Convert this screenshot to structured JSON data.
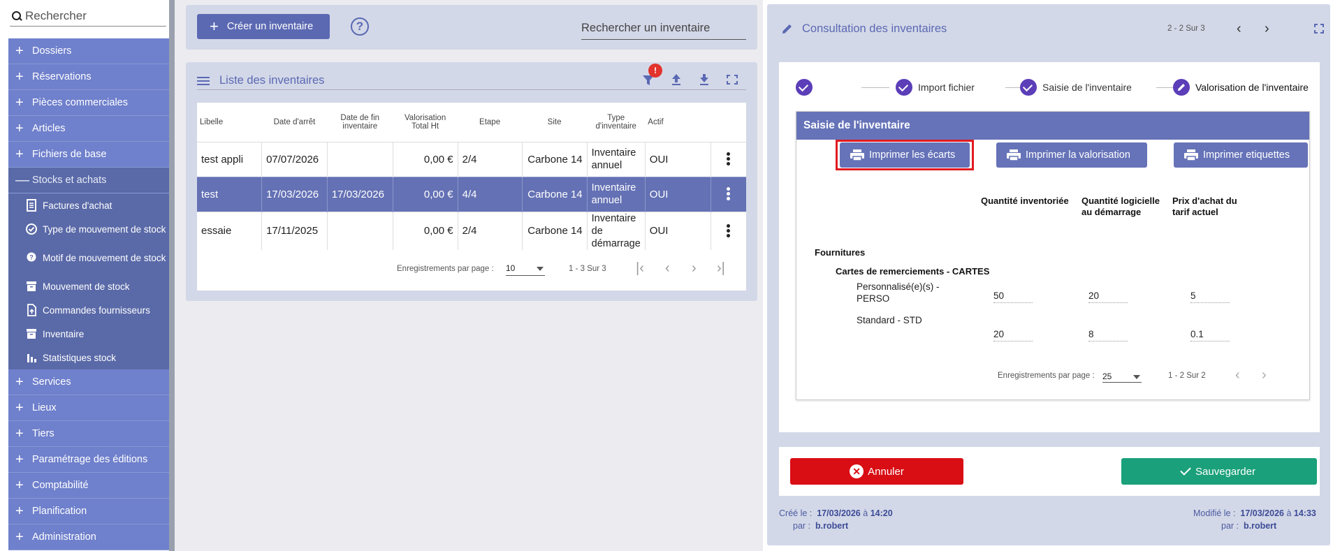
{
  "sidebar": {
    "search_placeholder": "Rechercher",
    "items_top": [
      "Dossiers",
      "Réservations",
      "Pièces commerciales",
      "Articles",
      "Fichiers de base"
    ],
    "open_item": "Stocks et achats",
    "sub_items": [
      "Factures d'achat",
      "Type de mouvement de stock",
      "Motif de mouvement de stock",
      "Mouvement de stock",
      "Commandes fournisseurs",
      "Inventaire",
      "Statistiques stock"
    ],
    "items_bottom": [
      "Services",
      "Lieux",
      "Tiers",
      "Paramétrage des éditions",
      "Comptabilité",
      "Planification",
      "Administration"
    ]
  },
  "toolbar": {
    "create_label": "Créer un inventaire",
    "search_placeholder": "Rechercher un inventaire"
  },
  "list": {
    "title": "Liste des inventaires",
    "filter_badge": "!",
    "columns": [
      "Libelle",
      "Date d'arrêt",
      "Date de fin inventaire",
      "Valorisation Total Ht",
      "Etape",
      "Site",
      "Type d'inventaire",
      "Actif"
    ],
    "rows": [
      {
        "libelle": "test appli",
        "date_arret": "07/07/2026",
        "date_fin": "",
        "valorisation": "0,00 €",
        "etape": "2/4",
        "site": "Carbone 14",
        "type": "Inventaire annuel",
        "actif": "OUI"
      },
      {
        "libelle": "test",
        "date_arret": "17/03/2026",
        "date_fin": "17/03/2026",
        "valorisation": "0,00 €",
        "etape": "4/4",
        "site": "Carbone 14",
        "type": "Inventaire annuel",
        "actif": "OUI"
      },
      {
        "libelle": "essaie",
        "date_arret": "17/11/2025",
        "date_fin": "",
        "valorisation": "0,00 €",
        "etape": "2/4",
        "site": "Carbone 14",
        "type": "Inventaire de démarrage",
        "actif": "OUI"
      }
    ],
    "pager": {
      "label": "Enregistrements par page :",
      "per_page": "10",
      "count": "1 - 3 Sur 3"
    }
  },
  "detail": {
    "title": "Consultation des inventaires",
    "count": "2 - 2 Sur 3",
    "steps": [
      "Import fichier",
      "Saisie de l'inventaire",
      "Valorisation de l'inventaire"
    ],
    "section_title": "Saisie de l'inventaire",
    "buttons": {
      "print_gaps": "Imprimer les écarts",
      "print_valuation": "Imprimer la valorisation",
      "print_labels": "Imprimer etiquettes"
    },
    "columns": {
      "qty_inv": "Quantité inventoriée",
      "qty_log": "Quantité logicielle au démarrage",
      "price": "Prix d'achat du tarif actuel"
    },
    "group": "Fournitures",
    "subgroup": "Cartes de remerciements - CARTES",
    "items": [
      {
        "label": "Personnalisé(e)(s) - PERSO",
        "qty_inv": "50",
        "qty_log": "20",
        "price": "5"
      },
      {
        "label": "Standard - STD",
        "qty_inv": "20",
        "qty_log": "8",
        "price": "0.1"
      }
    ],
    "pager": {
      "label": "Enregistrements par page :",
      "per_page": "25",
      "count": "1 - 2 Sur 2"
    }
  },
  "actions": {
    "cancel": "Annuler",
    "save": "Sauvegarder"
  },
  "meta": {
    "created_label": "Créé le :",
    "created_date": "17/03/2026",
    "created_at": "à",
    "created_time": "14:20",
    "by_label": "par :",
    "created_by": "b.robert",
    "modified_label": "Modifié le :",
    "modified_date": "17/03/2026",
    "modified_time": "14:33",
    "modified_by": "b.robert"
  },
  "colors": {
    "primary": "#5b69b3",
    "menu": "#6f80cc",
    "danger": "#d90d14",
    "success": "#1aa07a",
    "highlight": "#e01b22"
  }
}
